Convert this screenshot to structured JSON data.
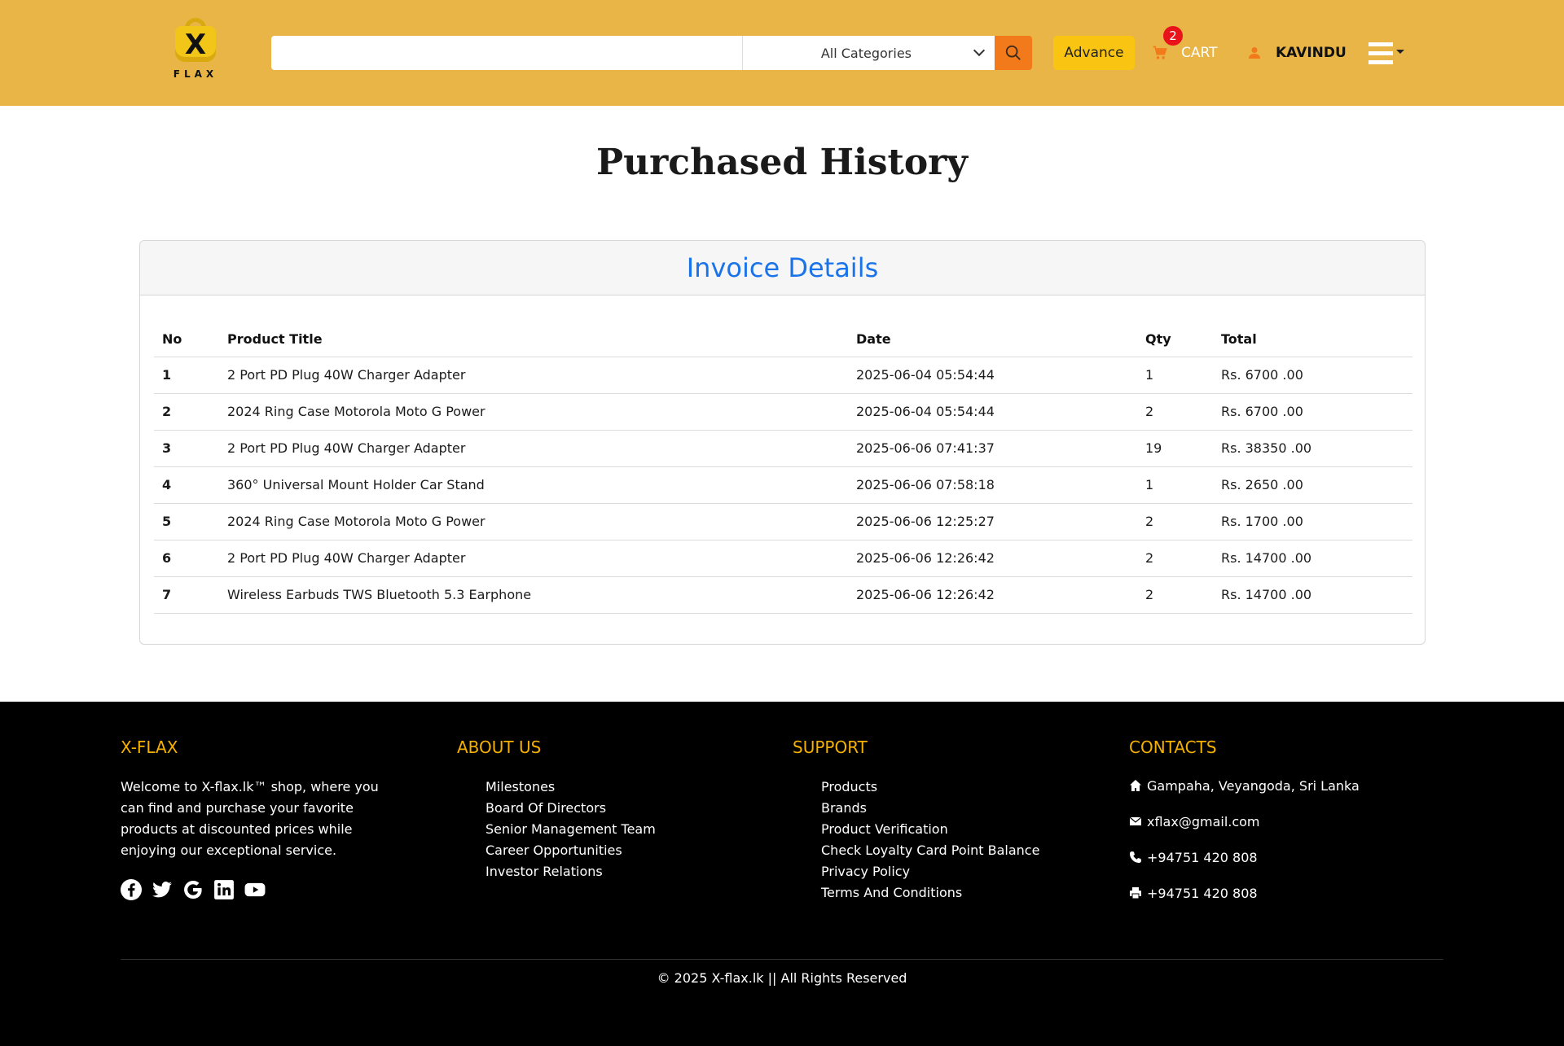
{
  "header": {
    "logo_text": "FLAX",
    "logo_mark": "X",
    "search": {
      "value": "",
      "placeholder": ""
    },
    "category": {
      "selected": "All Categories"
    },
    "advance_label": "Advance",
    "cart": {
      "count": "2",
      "label": "CART"
    },
    "user": {
      "name": "KAVINDU"
    }
  },
  "main": {
    "title": "Purchased History",
    "card_title": "Invoice Details",
    "columns": [
      "No",
      "Product Title",
      "Date",
      "Qty",
      "Total"
    ],
    "rows": [
      {
        "no": "1",
        "title": "2 Port PD Plug 40W Charger Adapter",
        "date": "2025-06-04 05:54:44",
        "qty": "1",
        "total": "Rs. 6700 .00"
      },
      {
        "no": "2",
        "title": "2024 Ring Case Motorola Moto G Power",
        "date": "2025-06-04 05:54:44",
        "qty": "2",
        "total": "Rs. 6700 .00"
      },
      {
        "no": "3",
        "title": "2 Port PD Plug 40W Charger Adapter",
        "date": "2025-06-06 07:41:37",
        "qty": "19",
        "total": "Rs. 38350 .00"
      },
      {
        "no": "4",
        "title": "360° Universal Mount Holder Car Stand",
        "date": "2025-06-06 07:58:18",
        "qty": "1",
        "total": "Rs. 2650 .00"
      },
      {
        "no": "5",
        "title": "2024 Ring Case Motorola Moto G Power",
        "date": "2025-06-06 12:25:27",
        "qty": "2",
        "total": "Rs. 1700 .00"
      },
      {
        "no": "6",
        "title": "2 Port PD Plug 40W Charger Adapter",
        "date": "2025-06-06 12:26:42",
        "qty": "2",
        "total": "Rs. 14700 .00"
      },
      {
        "no": "7",
        "title": "Wireless Earbuds TWS Bluetooth 5.3 Earphone",
        "date": "2025-06-06 12:26:42",
        "qty": "2",
        "total": "Rs. 14700 .00"
      }
    ]
  },
  "footer": {
    "brand": {
      "heading": "X-FLAX",
      "text": "Welcome to X-flax.lk™ shop, where you can find and purchase your favorite products at discounted prices while enjoying our exceptional service."
    },
    "about": {
      "heading": "ABOUT US",
      "links": [
        "Milestones",
        "Board Of Directors",
        "Senior Management Team",
        "Career Opportunities",
        "Investor Relations"
      ]
    },
    "support": {
      "heading": "SUPPORT",
      "links": [
        "Products",
        "Brands",
        "Product Verification",
        "Check Loyalty Card Point Balance",
        "Privacy Policy",
        "Terms And Conditions"
      ]
    },
    "contacts": {
      "heading": "CONTACTS",
      "address": "Gampaha, Veyangoda, Sri Lanka",
      "email": "xflax@gmail.com",
      "phone": "+94751 420 808",
      "fax": "+94751 420 808"
    },
    "social_icons": [
      "facebook-icon",
      "twitter-icon",
      "google-icon",
      "linkedin-icon",
      "youtube-icon"
    ],
    "copyright": "© 2025 X-flax.lk || All Rights Reserved"
  },
  "colors": {
    "header_bg": "#e9b546",
    "accent_orange": "#f27a1a",
    "advance_yellow": "#f9c512",
    "badge_red": "#e8131b",
    "link_blue": "#1a73e8",
    "footer_heading": "#f5b100"
  }
}
